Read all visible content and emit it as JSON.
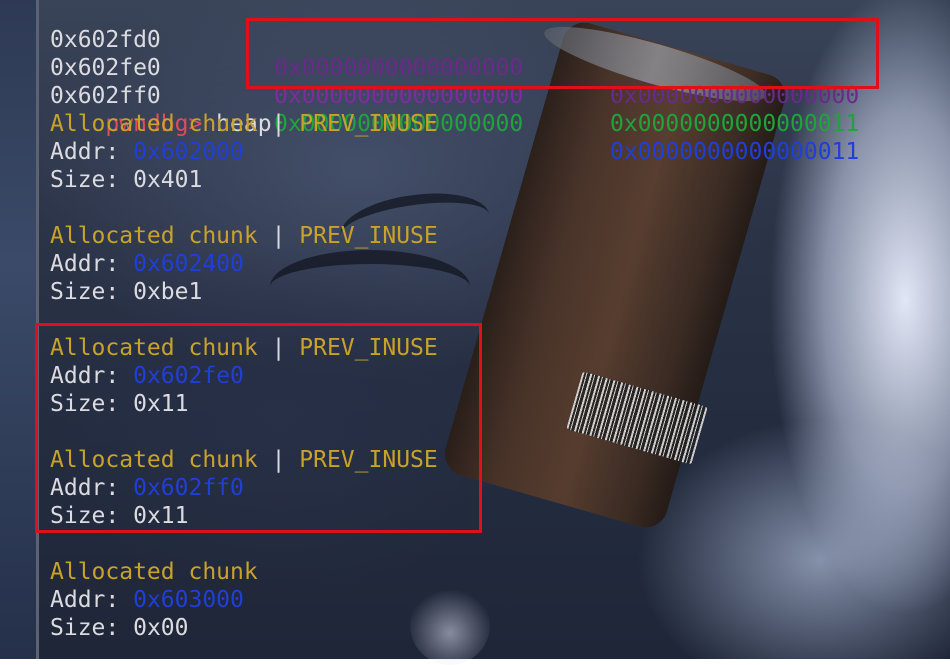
{
  "memory_dump": [
    {
      "addr": "0x602fd0",
      "q1": "0x0000000000000000",
      "q2": "0x0000000000000000",
      "q1_color": "#6a2a8a",
      "q2_color": "#6a2a8a"
    },
    {
      "addr": "0x602fe0",
      "q1": "0x0000000000000000",
      "q2": "0x0000000000000011",
      "q1_color": "#7e2c9e",
      "q2_color": "#1fa33a"
    },
    {
      "addr": "0x602ff0",
      "q1": "0x0000000000000000",
      "q2": "0x0000000000000011",
      "q1_color": "#1fa33a",
      "q2_color": "#1f3fd6"
    }
  ],
  "prompt": {
    "text": "pwndbg> ",
    "command": "heap"
  },
  "chunks": [
    {
      "status": "Allocated chunk",
      "separator": " | ",
      "flags": "PREV_INUSE",
      "addr_label": "Addr: ",
      "addr": "0x602000",
      "size_label": "Size: ",
      "size": "0x401"
    },
    {
      "status": "Allocated chunk",
      "separator": " | ",
      "flags": "PREV_INUSE",
      "addr_label": "Addr: ",
      "addr": "0x602400",
      "size_label": "Size: ",
      "size": "0xbe1"
    },
    {
      "status": "Allocated chunk",
      "separator": " | ",
      "flags": "PREV_INUSE",
      "addr_label": "Addr: ",
      "addr": "0x602fe0",
      "size_label": "Size: ",
      "size": "0x11"
    },
    {
      "status": "Allocated chunk",
      "separator": " | ",
      "flags": "PREV_INUSE",
      "addr_label": "Addr: ",
      "addr": "0x602ff0",
      "size_label": "Size: ",
      "size": "0x11"
    },
    {
      "status": "Allocated chunk",
      "separator": "",
      "flags": "",
      "addr_label": "Addr: ",
      "addr": "0x603000",
      "size_label": "Size: ",
      "size": "0x00"
    }
  ],
  "colors": {
    "highlight": "#e0101a",
    "prompt": "#e04b5a",
    "chunk_status": "#c9a227",
    "address": "#1f3fd6",
    "text": "#dcdce0"
  }
}
